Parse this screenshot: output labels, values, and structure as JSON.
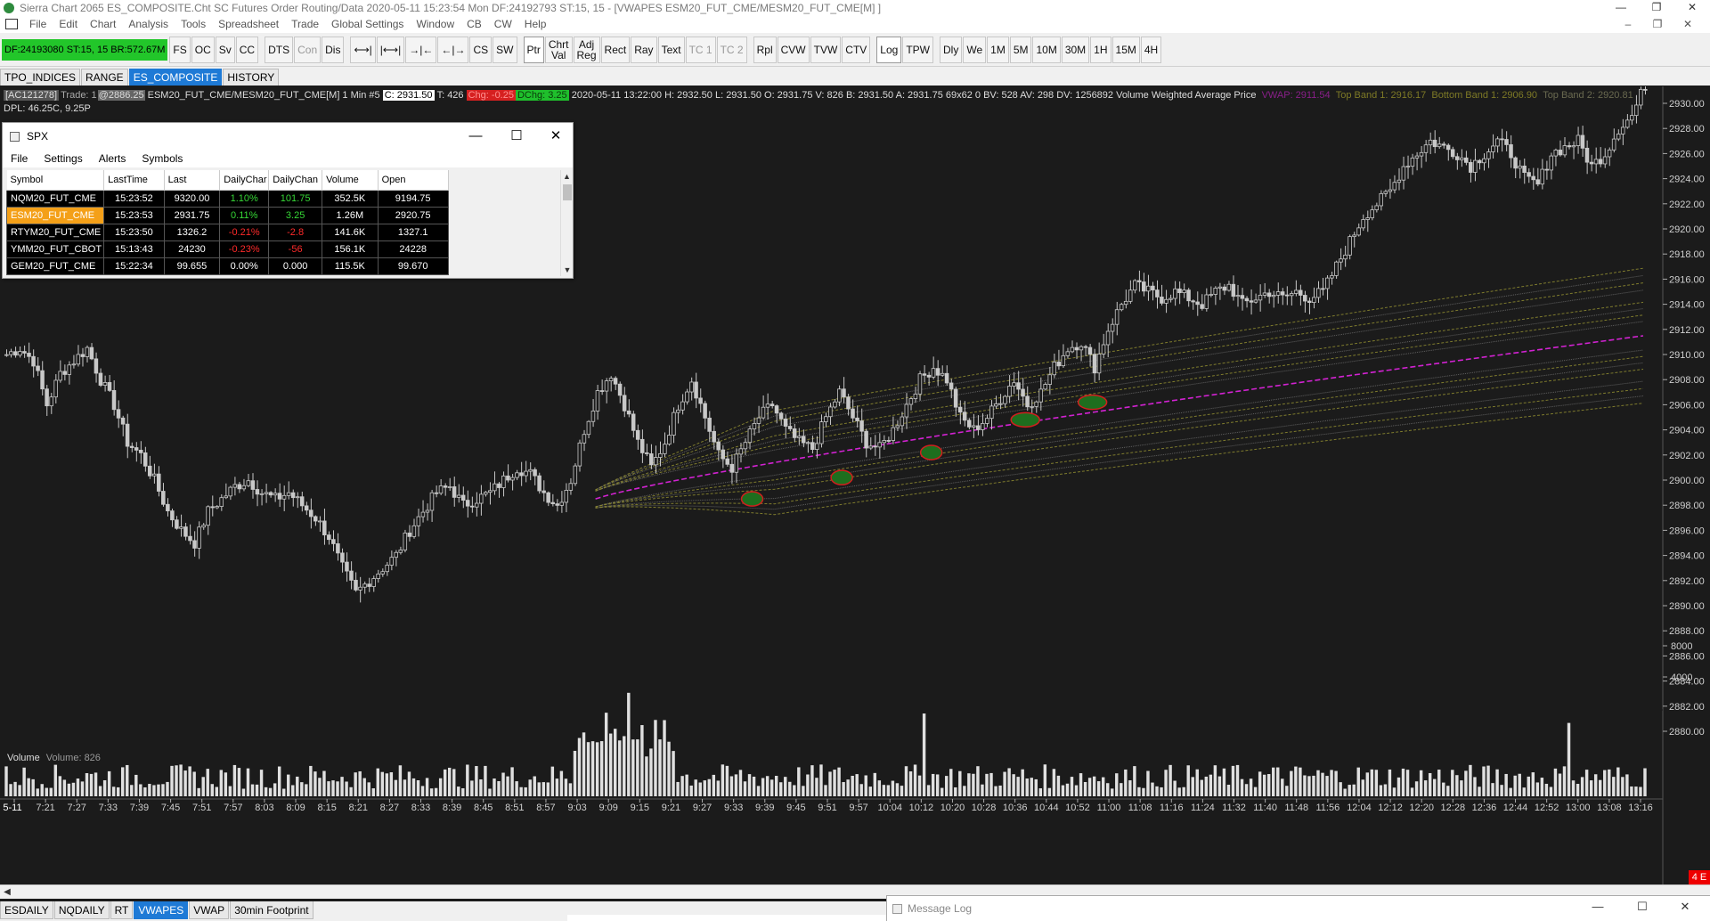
{
  "titlebar": {
    "text": "Sierra Chart 2065 ES_COMPOSITE.Cht  SC Futures Order Routing/Data 2020-05-11  15:23:54 Mon  DF:24192793  ST:15, 15 - [VWAPES  ESM20_FUT_CME/MESM20_FUT_CME[M] ]",
    "minimize": "—",
    "restore": "❐",
    "close": "✕"
  },
  "menubar": {
    "items": [
      "File",
      "Edit",
      "Chart",
      "Analysis",
      "Tools",
      "Spreadsheet",
      "Trade",
      "Global Settings",
      "Window",
      "CB",
      "CW",
      "Help"
    ],
    "minimize": "–",
    "restore": "❐",
    "close": "✕"
  },
  "toolbar": {
    "status": "DF:24193080  ST:15, 15  BR:572.67M",
    "buttons": [
      {
        "label": "FS",
        "style": "normal"
      },
      {
        "label": "OC",
        "style": "normal"
      },
      {
        "label": "Sv",
        "style": "normal"
      },
      {
        "label": "CC",
        "style": "normal"
      },
      {
        "label": "DTS",
        "style": "normal"
      },
      {
        "label": "Con",
        "style": "dim"
      },
      {
        "label": "Dis",
        "style": "normal"
      },
      {
        "label": "⟷|",
        "style": "normal"
      },
      {
        "label": "|⟷|",
        "style": "normal"
      },
      {
        "label": "→|←",
        "style": "normal"
      },
      {
        "label": "←|→",
        "style": "normal"
      },
      {
        "label": "CS",
        "style": "normal"
      },
      {
        "label": "SW",
        "style": "normal"
      },
      {
        "label": "Ptr",
        "style": "on"
      },
      {
        "label": "Chrt\nVal",
        "style": "normal"
      },
      {
        "label": "Adj\nReg",
        "style": "normal"
      },
      {
        "label": "Rect",
        "style": "normal"
      },
      {
        "label": "Ray",
        "style": "normal"
      },
      {
        "label": "Text",
        "style": "normal"
      },
      {
        "label": "TC 1",
        "style": "dim"
      },
      {
        "label": "TC 2",
        "style": "dim"
      },
      {
        "label": "Rpl",
        "style": "normal"
      },
      {
        "label": "CVW",
        "style": "normal"
      },
      {
        "label": "TVW",
        "style": "normal"
      },
      {
        "label": "CTV",
        "style": "normal"
      },
      {
        "label": "Log",
        "style": "on"
      },
      {
        "label": "TPW",
        "style": "normal"
      },
      {
        "label": "Dly",
        "style": "normal"
      },
      {
        "label": "We",
        "style": "normal"
      },
      {
        "label": "1M",
        "style": "normal"
      },
      {
        "label": "5M",
        "style": "normal"
      },
      {
        "label": "10M",
        "style": "normal"
      },
      {
        "label": "30M",
        "style": "normal"
      },
      {
        "label": "1H",
        "style": "normal"
      },
      {
        "label": "15M",
        "style": "normal"
      },
      {
        "label": "4H",
        "style": "normal"
      }
    ]
  },
  "chart_tabs": [
    {
      "label": "TPO_INDICES",
      "active": false
    },
    {
      "label": "RANGE",
      "active": false
    },
    {
      "label": "ES_COMPOSITE",
      "active": true
    },
    {
      "label": "HISTORY",
      "active": false
    }
  ],
  "infobar": {
    "account": "[AC121278]",
    "trade_label": "Trade: 1",
    "trade_value": "@2886.25",
    "symbol": "ESM20_FUT_CME/MESM20_FUT_CME[M]  1 Min  #5",
    "close": "C: 2931.50",
    "ticks": "T: 426",
    "chg": "Chg: -0.25",
    "dchg": "DChg: 3.25",
    "bar_info": "2020-05-11 13:22:00 H: 2932.50 L: 2931.50 O: 2931.75 V: 826 B: 2931.50 A: 2931.75 69x62 0 BV: 528 AV: 298 DV: 1256892 Volume Weighted Average Price",
    "vwap": "VWAP: 2911.54",
    "top_band_1": "Top Band 1: 2916.17",
    "bottom_band_1": "Bottom Band 1: 2906.90",
    "top_band_2": "Top Band 2: 2920.81",
    "dpl": "DPL: 46.25C, 9.25P"
  },
  "spx_window": {
    "title": "SPX",
    "minimize": "—",
    "maximize": "☐",
    "close": "✕",
    "menu": [
      "File",
      "Settings",
      "Alerts",
      "Symbols"
    ],
    "columns": [
      "Symbol",
      "LastTime",
      "Last",
      "DailyChar",
      "DailyChan",
      "Volume",
      "Open"
    ],
    "rows": [
      {
        "symbol": "NQM20_FUT_CME",
        "time": "15:23:52",
        "last": "9320.00",
        "chg_pct": "1.10%",
        "chg": "101.75",
        "volume": "352.5K",
        "open": "9194.75",
        "dir": "pos",
        "hl": false
      },
      {
        "symbol": "ESM20_FUT_CME",
        "time": "15:23:53",
        "last": "2931.75",
        "chg_pct": "0.11%",
        "chg": "3.25",
        "volume": "1.26M",
        "open": "2920.75",
        "dir": "pos",
        "hl": true
      },
      {
        "symbol": "RTYM20_FUT_CME",
        "time": "15:23:50",
        "last": "1326.2",
        "chg_pct": "-0.21%",
        "chg": "-2.8",
        "volume": "141.6K",
        "open": "1327.1",
        "dir": "neg",
        "hl": false
      },
      {
        "symbol": "YMM20_FUT_CBOT",
        "time": "15:13:43",
        "last": "24230",
        "chg_pct": "-0.23%",
        "chg": "-56",
        "volume": "156.1K",
        "open": "24228",
        "dir": "neg",
        "hl": false
      },
      {
        "symbol": "GEM20_FUT_CME",
        "time": "15:22:34",
        "last": "99.655",
        "chg_pct": "0.00%",
        "chg": "0.000",
        "volume": "115.5K",
        "open": "99.670",
        "dir": "none",
        "hl": false
      }
    ]
  },
  "chart_data": {
    "type": "candlestick",
    "symbol": "ESM20_FUT_CME/MESM20_FUT_CME[M]",
    "interval": "1 Min",
    "price_axis": {
      "min": 2880,
      "max": 2930,
      "ticks": [
        "2930.00",
        "2928.00",
        "2926.00",
        "2924.00",
        "2922.00",
        "2920.00",
        "2918.00",
        "2916.00",
        "2914.00",
        "2912.00",
        "2910.00",
        "2908.00",
        "2906.00",
        "2904.00",
        "2902.00",
        "2900.00",
        "2898.00",
        "2896.00",
        "2894.00",
        "2892.00",
        "2890.00",
        "2888.00",
        "2886.00",
        "2884.00",
        "2882.00",
        "2880.00"
      ]
    },
    "volume_axis": {
      "ticks": [
        "8000",
        "4000"
      ]
    },
    "time_labels": [
      "5-11",
      "7:21",
      "7:27",
      "7:33",
      "7:39",
      "7:45",
      "7:51",
      "7:57",
      "8:03",
      "8:09",
      "8:15",
      "8:21",
      "8:27",
      "8:33",
      "8:39",
      "8:45",
      "8:51",
      "8:57",
      "9:03",
      "9:09",
      "9:15",
      "9:21",
      "9:27",
      "9:33",
      "9:39",
      "9:45",
      "9:51",
      "9:57",
      "10:04",
      "10:12",
      "10:20",
      "10:28",
      "10:36",
      "10:44",
      "10:52",
      "11:00",
      "11:08",
      "11:16",
      "11:24",
      "11:32",
      "11:40",
      "11:48",
      "11:56",
      "12:04",
      "12:12",
      "12:20",
      "12:28",
      "12:36",
      "12:44",
      "12:52",
      "13:00",
      "13:08",
      "13:16"
    ],
    "close_path": [
      [
        0,
        2910
      ],
      [
        3,
        2910.5
      ],
      [
        6,
        2909.5
      ],
      [
        9,
        2906
      ],
      [
        12,
        2908.5
      ],
      [
        15,
        2909.5
      ],
      [
        18,
        2910.5
      ],
      [
        21,
        2908
      ],
      [
        24,
        2906
      ],
      [
        27,
        2903
      ],
      [
        30,
        2902
      ],
      [
        33,
        2900
      ],
      [
        36,
        2897.5
      ],
      [
        39,
        2896
      ],
      [
        42,
        2895
      ],
      [
        45,
        2897.5
      ],
      [
        48,
        2898.5
      ],
      [
        51,
        2899.5
      ],
      [
        54,
        2900
      ],
      [
        57,
        2899
      ],
      [
        60,
        2898.5
      ],
      [
        63,
        2899
      ],
      [
        66,
        2898
      ],
      [
        69,
        2897
      ],
      [
        72,
        2895.5
      ],
      [
        75,
        2893
      ],
      [
        78,
        2891
      ],
      [
        81,
        2892
      ],
      [
        84,
        2893
      ],
      [
        87,
        2894
      ],
      [
        90,
        2896
      ],
      [
        93,
        2897.5
      ],
      [
        96,
        2899
      ],
      [
        99,
        2899.5
      ],
      [
        102,
        2898
      ],
      [
        105,
        2898.5
      ],
      [
        108,
        2899
      ],
      [
        111,
        2900
      ],
      [
        114,
        2901
      ],
      [
        117,
        2900.5
      ],
      [
        120,
        2899
      ],
      [
        123,
        2898
      ],
      [
        126,
        2900
      ],
      [
        129,
        2904
      ],
      [
        132,
        2907
      ],
      [
        135,
        2908.5
      ],
      [
        138,
        2906
      ],
      [
        141,
        2903
      ],
      [
        144,
        2901
      ],
      [
        147,
        2903
      ],
      [
        150,
        2906
      ],
      [
        153,
        2908
      ],
      [
        156,
        2905
      ],
      [
        159,
        2902
      ],
      [
        162,
        2901
      ],
      [
        165,
        2903
      ],
      [
        168,
        2905
      ],
      [
        171,
        2906
      ],
      [
        174,
        2904
      ],
      [
        177,
        2903
      ],
      [
        180,
        2902.5
      ],
      [
        183,
        2905
      ],
      [
        186,
        2907
      ],
      [
        189,
        2905
      ],
      [
        192,
        2903
      ],
      [
        195,
        2902.5
      ],
      [
        198,
        2904
      ],
      [
        201,
        2906
      ],
      [
        204,
        2908
      ],
      [
        207,
        2909
      ],
      [
        210,
        2908
      ],
      [
        213,
        2905
      ],
      [
        216,
        2904
      ],
      [
        219,
        2905
      ],
      [
        222,
        2906.5
      ],
      [
        225,
        2908
      ],
      [
        228,
        2906
      ],
      [
        231,
        2907
      ],
      [
        234,
        2909
      ],
      [
        237,
        2910.5
      ],
      [
        240,
        2911
      ],
      [
        243,
        2909
      ],
      [
        246,
        2912
      ],
      [
        249,
        2914
      ],
      [
        252,
        2915.5
      ],
      [
        255,
        2915
      ],
      [
        258,
        2914.5
      ],
      [
        261,
        2915
      ],
      [
        264,
        2914.5
      ],
      [
        267,
        2914
      ],
      [
        270,
        2915
      ],
      [
        273,
        2915.5
      ],
      [
        276,
        2914
      ],
      [
        279,
        2914.5
      ],
      [
        282,
        2915
      ],
      [
        285,
        2914.5
      ],
      [
        288,
        2915
      ],
      [
        291,
        2914.5
      ],
      [
        294,
        2915
      ],
      [
        297,
        2917
      ],
      [
        300,
        2919
      ],
      [
        303,
        2921
      ],
      [
        306,
        2922
      ],
      [
        309,
        2923
      ],
      [
        312,
        2925
      ],
      [
        315,
        2926
      ],
      [
        318,
        2927
      ],
      [
        321,
        2926.5
      ],
      [
        324,
        2926
      ],
      [
        327,
        2925
      ],
      [
        330,
        2926
      ],
      [
        333,
        2927
      ],
      [
        336,
        2926
      ],
      [
        339,
        2924
      ],
      [
        342,
        2923.5
      ],
      [
        345,
        2926
      ],
      [
        348,
        2926.5
      ],
      [
        351,
        2927
      ],
      [
        354,
        2925
      ],
      [
        357,
        2926
      ],
      [
        360,
        2928
      ],
      [
        363,
        2929
      ],
      [
        366,
        2931.5
      ]
    ],
    "vwap_session_start_index": 132,
    "vwap_endpoint": 2911.54,
    "band_labels": [
      "VWAP",
      "Top Band 1",
      "Bottom Band 1",
      "Top Band 2"
    ],
    "band_values": [
      2911.54,
      2916.17,
      2906.9,
      2920.81
    ],
    "marked_lows_times": [
      "9:57",
      "10:20",
      "10:36",
      "11:00",
      "11:08"
    ],
    "volume_current": "826"
  },
  "volume_study": {
    "label": "Volume",
    "value": "Volume: 826"
  },
  "error_badge": "4 E",
  "bottom_tabs": [
    {
      "label": "ESDAILY",
      "active": false
    },
    {
      "label": "NQDAILY",
      "active": false
    },
    {
      "label": "RT",
      "active": false
    },
    {
      "label": "VWAPES",
      "active": true
    },
    {
      "label": "VWAP",
      "active": false
    },
    {
      "label": "30min Footprint",
      "active": false
    }
  ],
  "message_log": {
    "title": "Message Log",
    "minimize": "—",
    "restore": "☐",
    "close": "✕"
  },
  "colors": {
    "chart_bg": "#1b1b1b",
    "candle": "#c8c8c8",
    "vwap": "#d222d2",
    "band_gold": "#8a8630",
    "band_white": "#7a7a7a",
    "volume": "#e0e0e0",
    "circle_fill": "#1e6e1e",
    "circle_stroke": "#d21e1e"
  }
}
